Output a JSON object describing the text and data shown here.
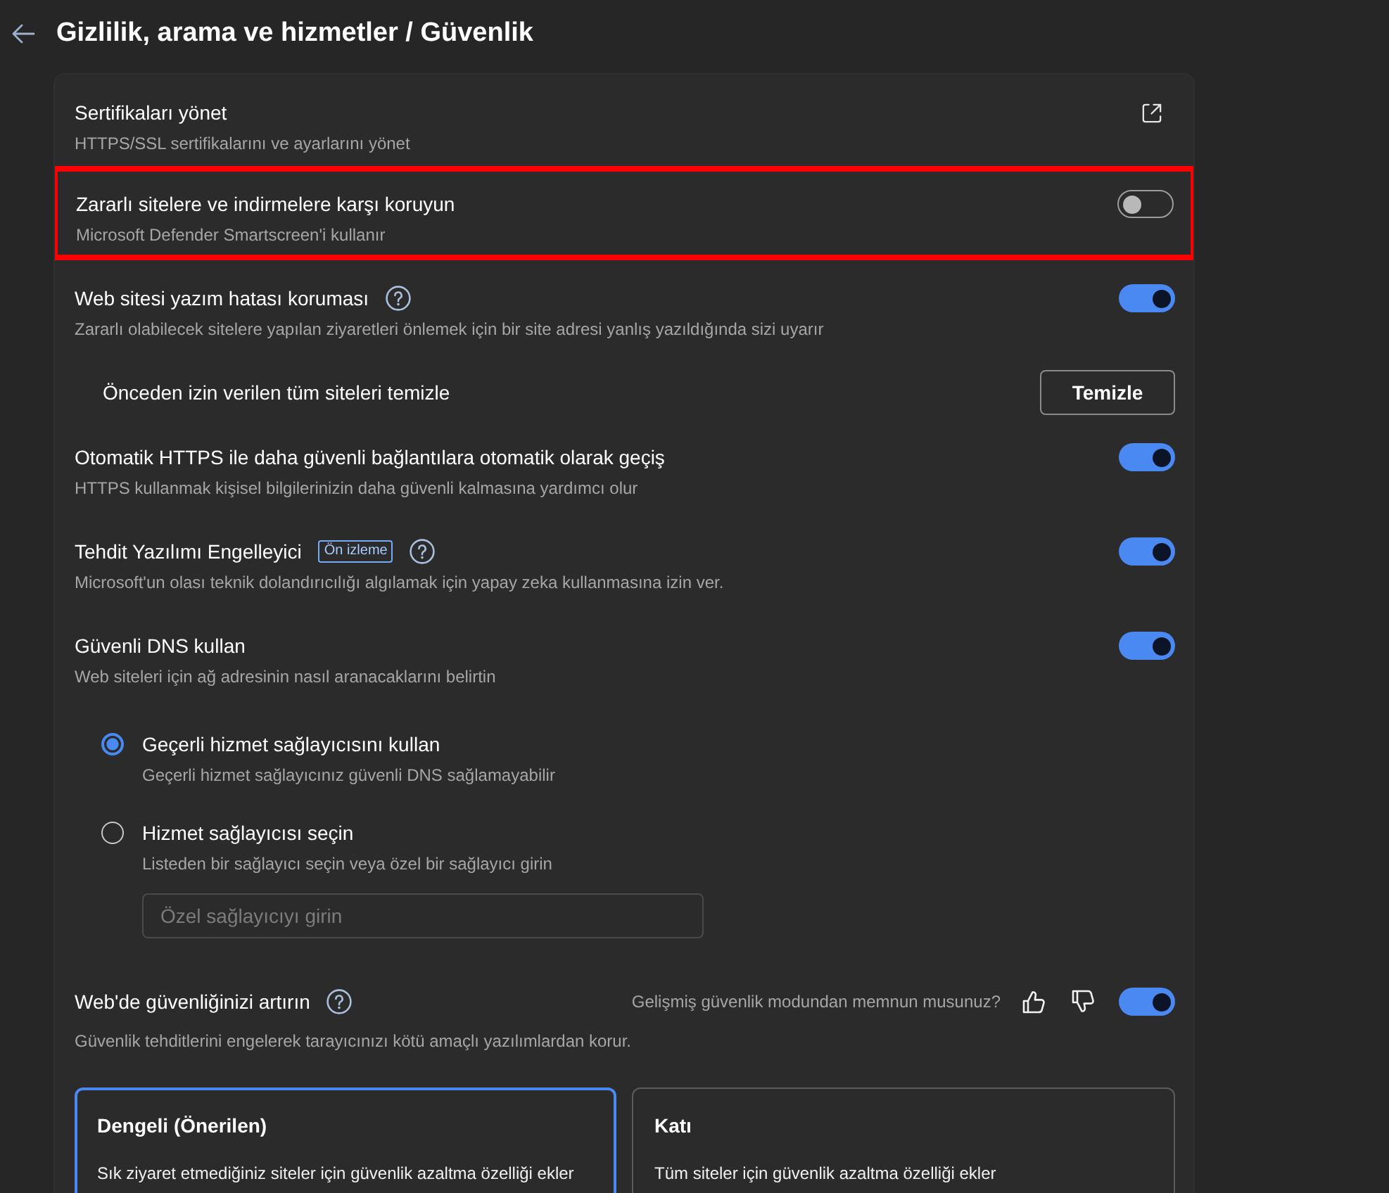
{
  "header": {
    "title": "Gizlilik, arama ve hizmetler / Güvenlik"
  },
  "settings": [
    {
      "kind": "link",
      "title": "Sertifikaları yönet",
      "description": "HTTPS/SSL sertifikalarını ve ayarlarını yönet",
      "highlighted": false
    },
    {
      "kind": "toggle",
      "title": "Zararlı sitelere ve indirmelere karşı koruyun",
      "description": "Microsoft Defender Smartscreen'i kullanır",
      "on": false,
      "highlighted": true
    },
    {
      "kind": "toggle",
      "title": "Web sitesi yazım hatası koruması",
      "help": true,
      "description": "Zararlı olabilecek sitelere yapılan ziyaretleri önlemek için bir site adresi yanlış yazıldığında sizi uyarır",
      "on": true,
      "highlighted": false
    },
    {
      "kind": "action",
      "title": "Önceden izin verilen tüm siteleri temizle",
      "button": "Temizle",
      "highlighted": false
    },
    {
      "kind": "toggle",
      "title": "Otomatik HTTPS ile daha güvenli bağlantılara otomatik olarak geçiş",
      "description": "HTTPS kullanmak kişisel bilgilerinizin daha güvenli kalmasına yardımcı olur",
      "on": true,
      "highlighted": false
    },
    {
      "kind": "toggle",
      "title": "Tehdit Yazılımı Engelleyici",
      "badge": "Ön izleme",
      "help": true,
      "description": "Microsoft'un olası teknik dolandırıcılığı algılamak için yapay zeka kullanmasına izin ver.",
      "on": true,
      "highlighted": false
    },
    {
      "kind": "toggle",
      "title": "Güvenli DNS kullan",
      "description": "Web siteleri için ağ adresinin nasıl aranacaklarını belirtin",
      "on": true,
      "highlighted": false,
      "options": [
        {
          "label": "Geçerli hizmet sağlayıcısını kullan",
          "description": "Geçerli hizmet sağlayıcınız güvenli DNS sağlamayabilir",
          "selected": true
        },
        {
          "label": "Hizmet sağlayıcısı seçin",
          "description": "Listeden bir sağlayıcı seçin veya özel bir sağlayıcı girin",
          "selected": false,
          "field": {
            "placeholder": "Özel sağlayıcıyı girin"
          }
        }
      ]
    },
    {
      "kind": "toggle",
      "title": "Web'de güvenliğinizi artırın",
      "help": true,
      "feedback": "Gelişmiş güvenlik modundan memnun musunuz?",
      "description": "Güvenlik tehditlerini engelerek tarayıcınızı kötü amaçlı yazılımlardan korur.",
      "on": true,
      "highlighted": false,
      "modes": [
        {
          "title": "Dengeli (Önerilen)",
          "description": "Sık ziyaret etmediğiniz siteler için güvenlik azaltma özelliği ekler",
          "selected": true
        },
        {
          "title": "Katı",
          "description": "Tüm siteler için güvenlik azaltma özelliği ekler",
          "selected": false
        }
      ]
    }
  ]
}
